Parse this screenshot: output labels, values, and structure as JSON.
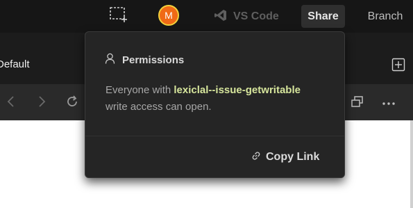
{
  "topbar": {
    "avatar_initial": "M",
    "vscode_label": "VS Code",
    "share_label": "Share",
    "branch_label": "Branch"
  },
  "tabbar": {
    "active_tab_label": "Default"
  },
  "permissions_popup": {
    "title": "Permissions",
    "message_prefix": "Everyone with",
    "branch_name": "lexiclal--issue-getwritable",
    "message_suffix": "write access can open.",
    "copy_link_label": "Copy Link"
  },
  "icons": {
    "add_preview": "add-preview-icon",
    "vscode": "vscode-icon",
    "add_tab": "add-tab-icon",
    "back": "chevron-left-icon",
    "forward": "chevron-right-icon",
    "reload": "reload-icon",
    "open_window": "open-window-icon",
    "more": "more-horizontal-icon",
    "person": "person-icon",
    "link": "link-icon"
  },
  "colors": {
    "topbar_bg": "#161616",
    "popup_bg": "#252525",
    "avatar_bg": "#f06a16",
    "avatar_ring": "#f2d23c",
    "branch_name_text": "#d6e59c"
  }
}
